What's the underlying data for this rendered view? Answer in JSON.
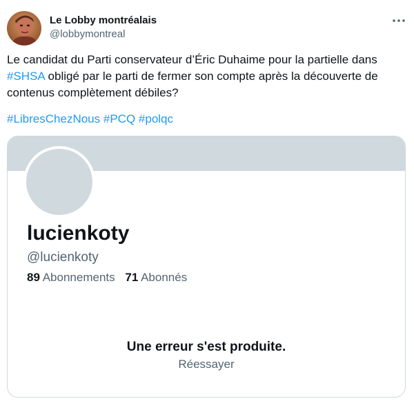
{
  "tweet": {
    "author": {
      "name": "Le Lobby montréalais",
      "handle": "@lobbymontreal",
      "avatar_icon": "profile-photo-icon"
    },
    "more_icon": "more-horizontal-icon",
    "text": {
      "line1": "Le candidat du Parti conservateur d’Éric Duhaime pour la partielle dans",
      "line2_hashtag": "#SHSA",
      "line2_rest": " obligé par le parti de fermer son compte après la découverte de",
      "line3": "contenus complètement débiles?"
    },
    "hashtags": [
      "#LibresChezNous",
      "#PCQ",
      "#polqc"
    ],
    "colors": {
      "link": "#1d9bf0",
      "secondary_text": "#536471",
      "placeholder": "#cfd9de"
    }
  },
  "card": {
    "profile_name": "lucienkoty",
    "profile_handle": "@lucienkoty",
    "following_count": "89",
    "following_label": "Abonnements",
    "followers_count": "71",
    "followers_label": "Abonnés",
    "error_title": "Une erreur s'est produite.",
    "retry_label": "Réessayer"
  }
}
